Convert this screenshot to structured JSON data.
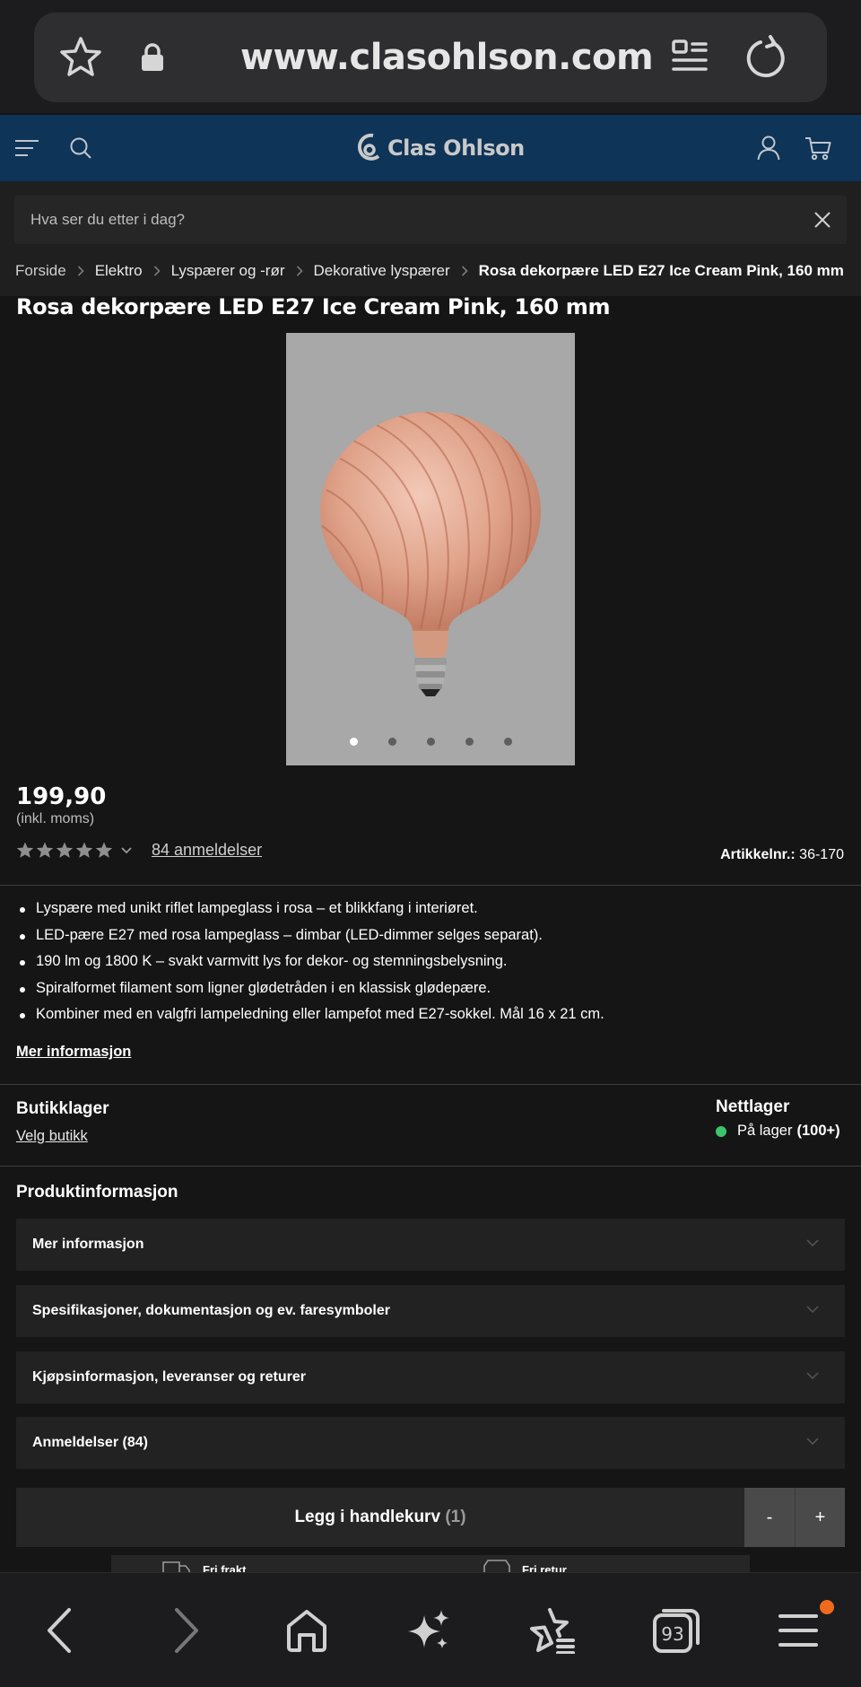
{
  "browser": {
    "url": "www.clasohlson.com",
    "tab_count": "93",
    "icons": [
      "star-icon",
      "lock-icon",
      "reader-icon",
      "reload-icon",
      "back-icon",
      "forward-icon",
      "home-icon",
      "sparkle-icon",
      "favorites-icon",
      "tabs-icon",
      "menu-icon"
    ]
  },
  "header": {
    "brand": "Clas Ohlson",
    "accent_color": "#0e3457"
  },
  "search": {
    "placeholder": "Hva ser du etter i dag?"
  },
  "breadcrumb": [
    "Forside",
    "Elektro",
    "Lyspærer og -rør",
    "Dekorative lyspærer",
    "Rosa dekorpære LED E27 Ice Cream Pink, 160 mm"
  ],
  "product": {
    "title": "Rosa dekorpære LED E27 Ice Cream Pink, 160 mm",
    "image_dots": 5,
    "active_image": 1,
    "price": "199,90",
    "price_note": "(inkl. moms)",
    "rating_stars": 5,
    "reviews_link": "84 anmeldelser",
    "article_label": "Artikkelnr.:",
    "article_number": "36-170",
    "features": [
      "Lyspære med unikt riflet lampeglass i rosa – et blikkfang i interiøret.",
      "LED-pære E27 med rosa lampeglass – dimbar (LED-dimmer selges separat).",
      "190 lm og 1800 K – svakt varmvitt lys for dekor- og stemningsbelysning.",
      "Spiralformet filament som ligner glødetråden i en klassisk glødepære.",
      "Kombiner med en valgfri lampeledning eller lampefot med E27-sokkel. Mål 16 x 21 cm."
    ],
    "more_info_link": "Mer informasjon"
  },
  "stock": {
    "store_title": "Butikklager",
    "store_link": "Velg butikk",
    "online_title": "Nettlager",
    "online_status": "På lager",
    "online_qty": "(100+)",
    "status_color": "#3cc46a"
  },
  "product_info": {
    "title": "Produktinformasjon",
    "sections": [
      "Mer informasjon",
      "Spesifikasjoner, dokumentasjon og ev. faresymboler",
      "Kjøpsinformasjon, leveranser og returer",
      "Anmeldelser (84)"
    ]
  },
  "cart": {
    "label": "Legg i handlekurv",
    "qty": "(1)",
    "minus": "-",
    "plus": "+"
  },
  "shipping": {
    "free_shipping": "Fri frakt",
    "free_return": "Fri retur"
  }
}
